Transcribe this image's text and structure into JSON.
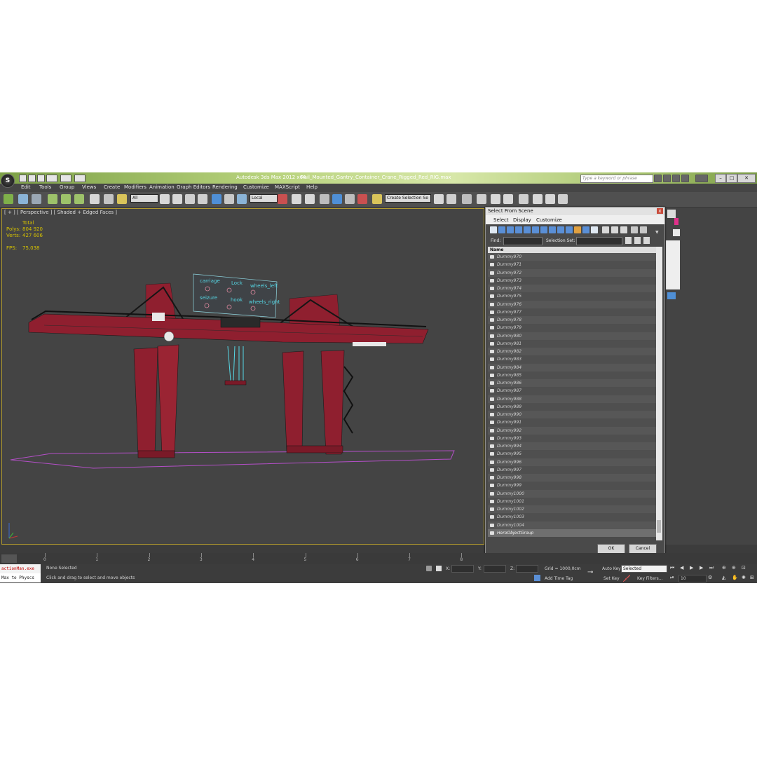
{
  "titlebar": {
    "app_title": "Autodesk 3ds Max  2012 x64",
    "file_title": "Rail_Mounted_Gantry_Container_Crane_Rigged_Red_RIG.max",
    "search_placeholder": "Type a keyword or phrase",
    "min": "–",
    "max": "□",
    "close": "✕"
  },
  "menu": {
    "items": [
      "Edit",
      "Tools",
      "Group",
      "Views",
      "Create",
      "Modifiers",
      "Animation",
      "Graph Editors",
      "Rendering",
      "Customize",
      "MAXScript",
      "Help"
    ]
  },
  "toolbar": {
    "selection_filter": "All",
    "ref_coord": "Local",
    "named_selection_placeholder": "Create Selection Se"
  },
  "viewport": {
    "label": "[ + ] [ Perspective ] [ Shaded + Edged Faces ]",
    "stats_total_label": "Total",
    "polys_label": "Polys:",
    "polys_value": "804 920",
    "verts_label": "Verts:",
    "verts_value": "427 606",
    "fps_label": "FPS:",
    "fps_value": "75,038",
    "board_labels": [
      "carriage",
      "Lock",
      "wheels_left",
      "seizure",
      "hook",
      "wheels_right"
    ]
  },
  "dialog": {
    "title": "Select From Scene",
    "close": "x",
    "menu": [
      "Select",
      "Display",
      "Customize"
    ],
    "find_label": "Find:",
    "selection_set_label": "Selection Set:",
    "column_name": "Name",
    "items": [
      "Dummy970",
      "Dummy971",
      "Dummy972",
      "Dummy973",
      "Dummy974",
      "Dummy975",
      "Dummy976",
      "Dummy977",
      "Dummy978",
      "Dummy979",
      "Dummy980",
      "Dummy981",
      "Dummy982",
      "Dummy983",
      "Dummy984",
      "Dummy985",
      "Dummy986",
      "Dummy987",
      "Dummy988",
      "Dummy989",
      "Dummy990",
      "Dummy991",
      "Dummy992",
      "Dummy993",
      "Dummy994",
      "Dummy995",
      "Dummy996",
      "Dummy997",
      "Dummy998",
      "Dummy999",
      "Dummy1000",
      "Dummy1001",
      "Dummy1002",
      "Dummy1003",
      "Dummy1004",
      "HeroObjectGroup"
    ],
    "ok": "OK",
    "cancel": "Cancel"
  },
  "timeline": {
    "ticks": [
      "0",
      "1",
      "2",
      "3",
      "4",
      "5",
      "6",
      "7",
      "8"
    ]
  },
  "status": {
    "listener_1": "actionMan.exe",
    "listener_2": "Max to Physcs",
    "selection_text": "None Selected",
    "prompt_text": "Click and drag to select and move objects",
    "x_label": "X:",
    "y_label": "Y:",
    "z_label": "Z:",
    "grid_text": "Grid = 1000,0cm",
    "add_time_tag": "Add Time Tag",
    "auto_key": "Auto Key",
    "set_key": "Set Key",
    "selected_dd": "Selected",
    "key_filters": "Key Filters...",
    "frame_value": "10"
  },
  "colors": {
    "crane_red": "#8f1f2f",
    "viewport_bg": "#444444",
    "title_green": "#b7d27c",
    "stats_yellow": "#d6c200",
    "board_cyan": "#56d8e6"
  }
}
